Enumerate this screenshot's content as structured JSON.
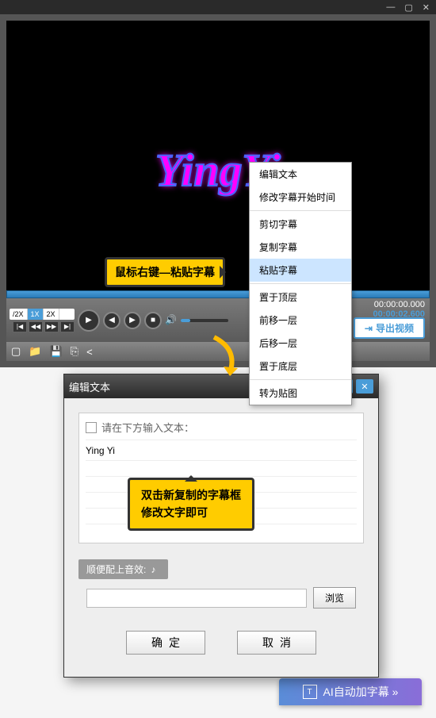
{
  "titlebar": {
    "min": "—",
    "max": "▢",
    "close": "✕"
  },
  "video": {
    "logo_text": "YingYi"
  },
  "tooltip1": "鼠标右键—粘贴字幕",
  "context_menu": {
    "items": [
      "编辑文本",
      "修改字幕开始时间",
      "剪切字幕",
      "复制字幕",
      "粘贴字幕",
      "置于顶层",
      "前移一层",
      "后移一层",
      "置于底层",
      "转为贴图"
    ],
    "highlighted_index": 4,
    "separators_after": [
      1,
      4,
      8
    ]
  },
  "controls": {
    "speeds": [
      "/2X",
      "1X",
      "2X"
    ],
    "active_speed_index": 1,
    "time_current": "00:00:00.000",
    "time_total": "00:00:02.600",
    "export_label": "导出视频"
  },
  "dialog": {
    "title": "编辑文本",
    "input_label": "请在下方输入文本：",
    "input_value": "Ying Yi",
    "tooltip2_line1": "双击新复制的字幕框",
    "tooltip2_line2": "修改文字即可",
    "audio_label": "顺便配上音效:",
    "browse_label": "浏览",
    "ok_label": "确定",
    "cancel_label": "取消"
  },
  "ai_button": "AI自动加字幕 »"
}
